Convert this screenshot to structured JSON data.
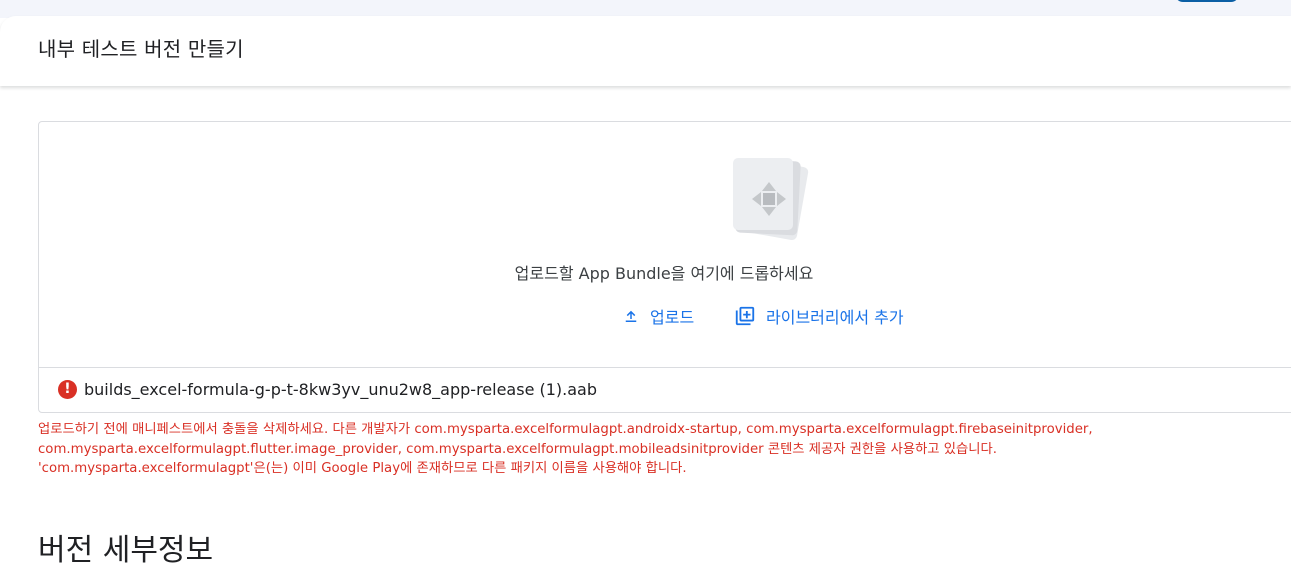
{
  "header": {
    "title": "내부 테스트 버전 만들기"
  },
  "dropzone": {
    "drop_text": "업로드할 App Bundle을 여기에 드롭하세요",
    "upload_label": "업로드",
    "library_label": "라이브러리에서 추가"
  },
  "file": {
    "name": "builds_excel-formula-g-p-t-8kw3yv_unu2w8_app-release (1).aab",
    "error_icon": "!"
  },
  "error": {
    "lines": [
      "업로드하기 전에 매니페스트에서 충돌을 삭제하세요. 다른 개발자가 com.mysparta.excelformulagpt.androidx-startup, com.mysparta.excelformulagpt.firebaseinitprovider,",
      "com.mysparta.excelformulagpt.flutter.image_provider, com.mysparta.excelformulagpt.mobileadsinitprovider 콘텐츠 제공자 권한을 사용하고 있습니다.",
      "'com.mysparta.excelformulagpt'은(는) 이미 Google Play에 존재하므로 다른 패키지 이름을 사용해야 합니다."
    ]
  },
  "section": {
    "title": "버전 세부정보"
  },
  "colors": {
    "accent": "#1a73e8",
    "error": "#d93025",
    "border": "#dadce0"
  },
  "icons": {
    "upload": "upload-icon",
    "library": "library-add-icon",
    "error": "error-icon",
    "bundle": "app-bundle-illustration"
  }
}
